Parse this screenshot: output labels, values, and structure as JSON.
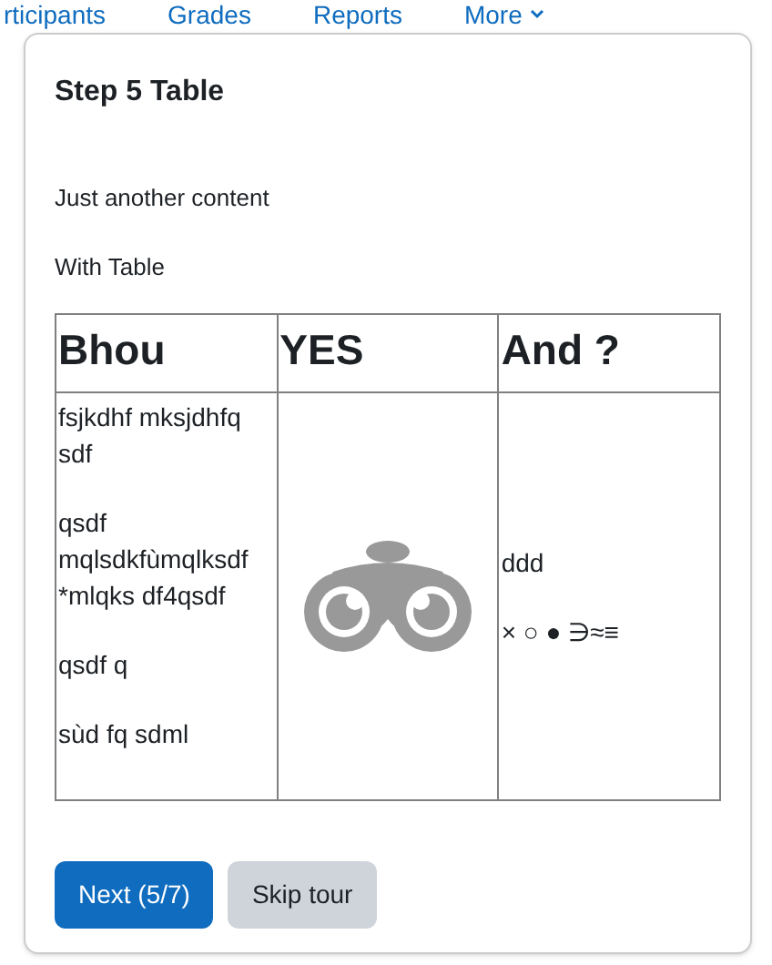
{
  "nav": [
    {
      "label": "rticipants"
    },
    {
      "label": "Grades"
    },
    {
      "label": "Reports"
    },
    {
      "label": "More",
      "dropdown": true
    }
  ],
  "popover": {
    "title": "Step 5 Table",
    "paragraphs": [
      "Just another content",
      "With Table"
    ],
    "table": {
      "columns": [
        "Bhou",
        "YES",
        "And ?"
      ],
      "cells": [
        {
          "kind": "text",
          "paragraphs": [
            "fsjkdhf mksjdhfq sdf",
            "qsdf mqlsdkfùmqlksdf *mlqks df4qsdf",
            "qsdf q",
            "sùd fq sdml"
          ]
        },
        {
          "kind": "picture"
        },
        {
          "kind": "text",
          "paragraphs": [
            "ddd",
            "× ○ ● ∋≈≡"
          ]
        }
      ]
    },
    "buttons": [
      {
        "label": "Next (5/7)",
        "kind": "primary"
      },
      {
        "label": "Skip tour",
        "kind": "secondary"
      }
    ]
  }
}
